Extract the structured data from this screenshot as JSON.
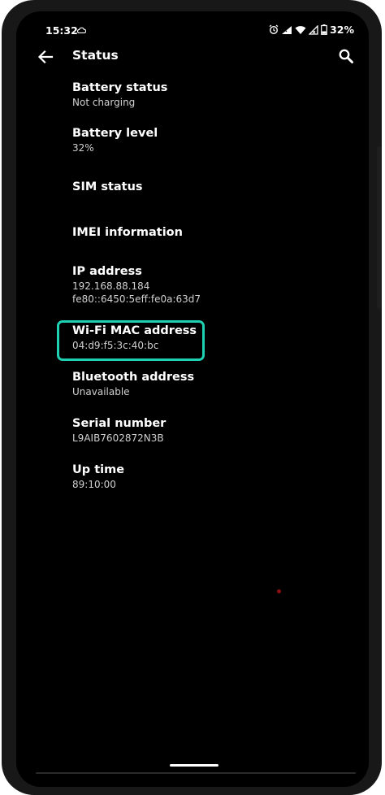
{
  "status_bar": {
    "time": "15:32",
    "battery": "32%"
  },
  "app_bar": {
    "title": "Status"
  },
  "items": [
    {
      "title": "Battery status",
      "values": [
        "Not charging"
      ]
    },
    {
      "title": "Battery level",
      "values": [
        "32%"
      ]
    },
    {
      "title": "SIM status",
      "values": []
    },
    {
      "title": "IMEI information",
      "values": []
    },
    {
      "title": "IP address",
      "values": [
        "192.168.88.184",
        "fe80::6450:5eff:fe0a:63d7"
      ]
    },
    {
      "title": "Wi-Fi MAC address",
      "values": [
        "04:d9:f5:3c:40:bc"
      ]
    },
    {
      "title": "Bluetooth address",
      "values": [
        "Unavailable"
      ]
    },
    {
      "title": "Serial number",
      "values": [
        "L9AIB7602872N3B"
      ]
    },
    {
      "title": "Up time",
      "values": [
        "89:10:00"
      ]
    }
  ],
  "icons": {
    "back": "arrow-back-icon",
    "search": "search-icon",
    "status": [
      "cloud-icon",
      "alarm-icon",
      "signal-icon",
      "wifi-icon",
      "no-signal-icon",
      "battery-icon"
    ]
  },
  "colors": {
    "background": "#000000",
    "text_primary": "#ffffff",
    "text_secondary": "#d0d0d0",
    "highlight": "#1fd1b3"
  }
}
